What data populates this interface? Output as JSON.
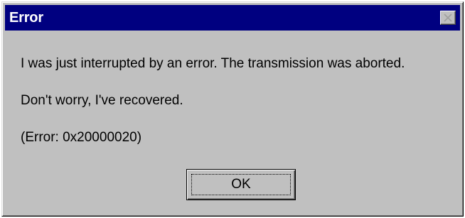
{
  "window": {
    "title": "Error",
    "close_icon": "close-icon",
    "titlebar_color": "#000080",
    "face_color": "#c0c0c0"
  },
  "message": {
    "line1": "I was just interrupted by an error.  The transmission was aborted.",
    "line2": "Don't worry, I've recovered.",
    "line3": "(Error: 0x20000020)"
  },
  "buttons": {
    "ok_label": "OK"
  }
}
